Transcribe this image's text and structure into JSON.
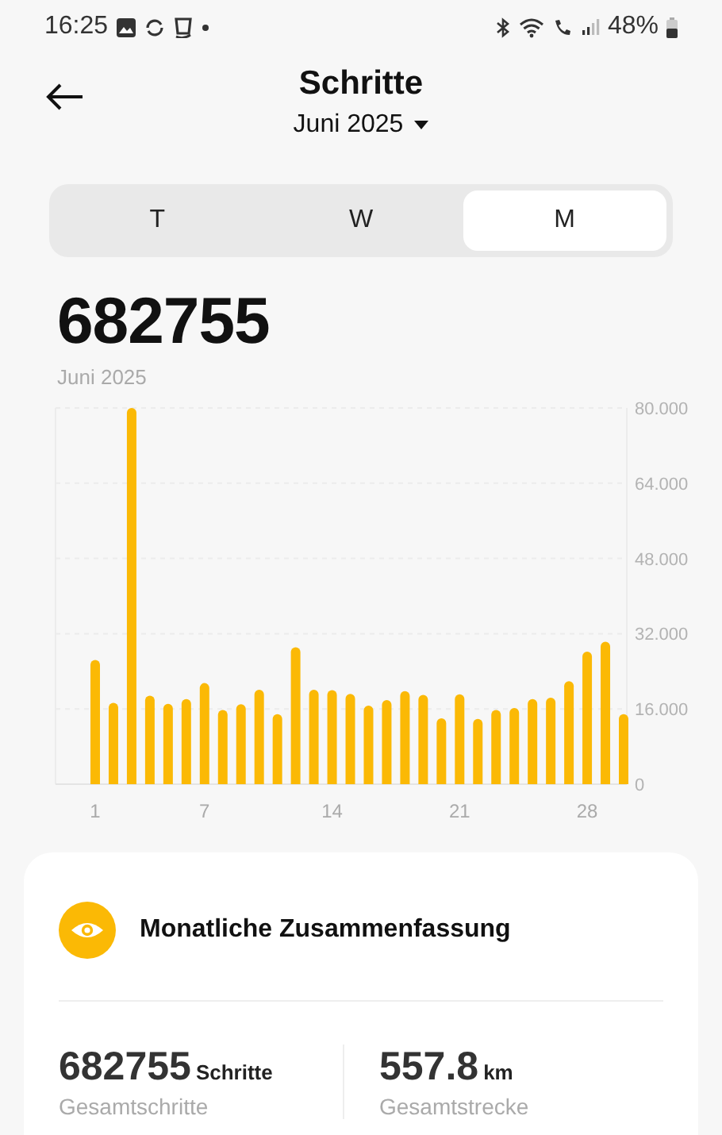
{
  "status_bar": {
    "time": "16:25",
    "battery": "48%"
  },
  "header": {
    "title": "Schritte",
    "period": "Juni 2025"
  },
  "tabs": [
    {
      "label": "T",
      "selected": false
    },
    {
      "label": "W",
      "selected": false
    },
    {
      "label": "M",
      "selected": true
    }
  ],
  "total": {
    "value": "682755",
    "caption": "Juni 2025"
  },
  "chart": {
    "chart_data": {
      "type": "bar",
      "categories": [
        "1",
        null,
        null,
        null,
        null,
        null,
        "7",
        null,
        null,
        null,
        null,
        null,
        null,
        "14",
        null,
        null,
        null,
        null,
        null,
        null,
        "21",
        null,
        null,
        null,
        null,
        null,
        null,
        "28",
        null,
        null
      ],
      "grid": true,
      "series": [
        {
          "color": "#fbb905",
          "values": [
            26.4,
            17.3,
            80,
            18.8,
            17.1,
            18.1,
            21.5,
            15.8,
            17,
            20.1,
            14.9,
            29.1,
            20.1,
            20,
            19.2,
            16.7,
            17.9,
            19.8,
            19,
            14,
            19.1,
            13.9,
            15.8,
            16.2,
            18.1,
            18.4,
            21.9,
            28.2,
            30.3,
            14.9
          ]
        }
      ],
      "ylim": [
        0,
        80
      ],
      "yticks": [
        {
          "value": 0,
          "label": "0"
        },
        {
          "value": 16,
          "label": "16.000"
        },
        {
          "value": 32,
          "label": "32.000"
        },
        {
          "value": 48,
          "label": "48.000"
        },
        {
          "value": 64,
          "label": "64.000"
        },
        {
          "value": 80,
          "label": "80.000"
        }
      ]
    }
  },
  "summary": {
    "title": "Monatliche Zusammenfassung",
    "stats": [
      {
        "value": "682755",
        "unit": "Schritte",
        "label": "Gesamtschritte"
      },
      {
        "value": "557.8",
        "unit": "km",
        "label": "Gesamtstrecke"
      }
    ]
  }
}
